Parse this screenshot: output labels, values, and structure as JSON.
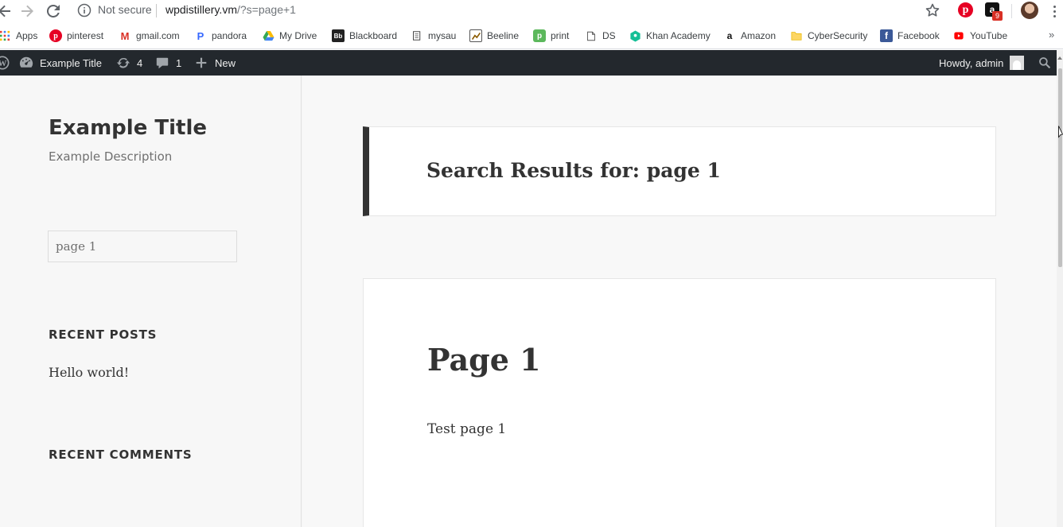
{
  "browser": {
    "url_security": "Not secure",
    "url_host": "wpdistillery.vm",
    "url_path": "/?s=page+1",
    "extension_badge": "9",
    "extension_amazon_letter": "a",
    "extension_pinterest_letter": "p"
  },
  "bookmarks": [
    {
      "label": "Apps",
      "icon": "apps-grid-icon"
    },
    {
      "label": "pinterest",
      "icon": "pinterest-icon"
    },
    {
      "label": "gmail.com",
      "icon": "gmail-icon"
    },
    {
      "label": "pandora",
      "icon": "pandora-icon"
    },
    {
      "label": "My Drive",
      "icon": "google-drive-icon"
    },
    {
      "label": "Blackboard",
      "icon": "blackboard-icon"
    },
    {
      "label": "mysau",
      "icon": "document-icon"
    },
    {
      "label": "Beeline",
      "icon": "beeline-icon"
    },
    {
      "label": "print",
      "icon": "print-icon"
    },
    {
      "label": "DS",
      "icon": "page-icon"
    },
    {
      "label": "Khan Academy",
      "icon": "khan-academy-icon"
    },
    {
      "label": "Amazon",
      "icon": "amazon-icon"
    },
    {
      "label": "CyberSecurity",
      "icon": "folder-icon"
    },
    {
      "label": "Facebook",
      "icon": "facebook-icon"
    },
    {
      "label": "YouTube",
      "icon": "youtube-icon"
    }
  ],
  "bookmark_more": "»",
  "adminbar": {
    "site_name": "Example Title",
    "updates_count": "4",
    "comments_count": "1",
    "new_label": "New",
    "howdy": "Howdy, admin"
  },
  "sidebar": {
    "site_title": "Example Title",
    "site_description": "Example Description",
    "search_value": "page 1",
    "recent_posts_title": "RECENT POSTS",
    "recent_post_1": "Hello world!",
    "recent_comments_title": "RECENT COMMENTS"
  },
  "main": {
    "results_title": "Search Results for: page 1",
    "post_title": "Page 1",
    "post_excerpt": "Test page 1"
  },
  "colors": {
    "adminbar_bg": "#23282d",
    "accent_border": "#333333"
  }
}
